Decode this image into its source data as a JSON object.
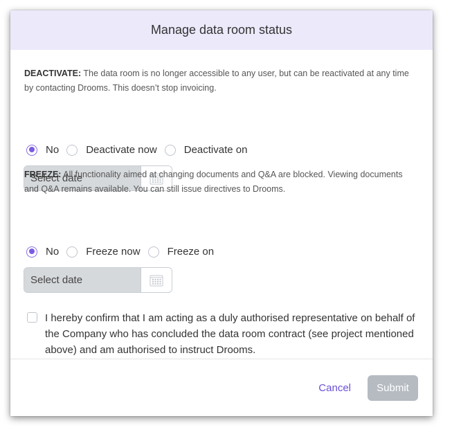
{
  "dialog": {
    "title": "Manage data room status"
  },
  "deactivate": {
    "heading": "DEACTIVATE:",
    "description": " The data room is no longer accessible to any user, but can be reactivated at any time by contacting Drooms. This doesn’t stop invoicing.",
    "options": [
      "No",
      "Deactivate now",
      "Deactivate on"
    ],
    "selected": "No",
    "date_placeholder": "Select date"
  },
  "freeze": {
    "heading": "FREEZE:",
    "description": " All functionality aimed at changing documents and Q&A are blocked. Viewing documents and Q&A remains available. You can still issue directives to Drooms.",
    "options": [
      "No",
      "Freeze now",
      "Freeze on"
    ],
    "selected": "No",
    "date_placeholder": "Select date"
  },
  "confirmation": {
    "text": "I hereby confirm that I am acting as a duly authorised representative on behalf of the Company who has concluded the data room contract (see project mentioned above) and am authorised to instruct Drooms.",
    "checked": false
  },
  "footer": {
    "cancel_label": "Cancel",
    "submit_label": "Submit"
  },
  "colors": {
    "accent": "#7a5ce0",
    "header_bg": "#ece9fb",
    "disabled_button": "#b6bbc2"
  },
  "icons": {
    "calendar": "calendar-icon"
  }
}
